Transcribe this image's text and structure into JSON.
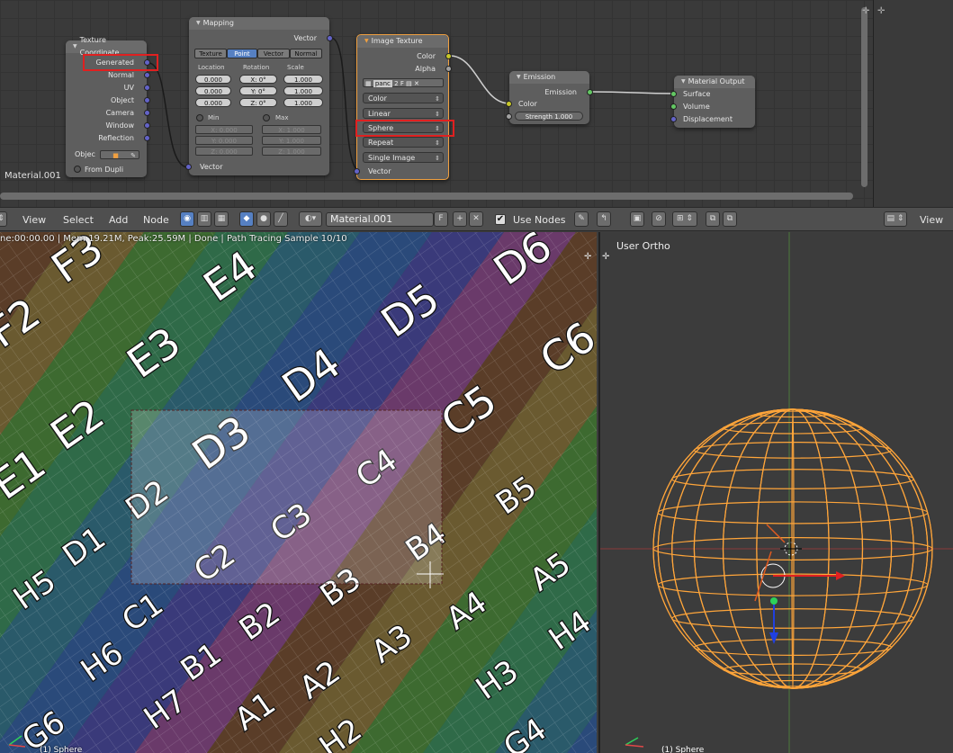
{
  "node_editor": {
    "material_label": "Material.001",
    "nodes": {
      "texture_coordinate": {
        "title": "Texture Coordinate",
        "outputs": [
          "Generated",
          "Normal",
          "UV",
          "Object",
          "Camera",
          "Window",
          "Reflection"
        ],
        "object_label": "Objec",
        "from_dupli": "From Dupli"
      },
      "mapping": {
        "title": "Mapping",
        "output": "Vector",
        "tabs": [
          "Texture",
          "Point",
          "Vector",
          "Normal"
        ],
        "active_tab": "Point",
        "col_labels": [
          "Location",
          "Rotation",
          "Scale"
        ],
        "location": [
          "0.000",
          "0.000",
          "0.000"
        ],
        "rotation": [
          "X: 0°",
          "Y: 0°",
          "Z: 0°"
        ],
        "scale": [
          "1.000",
          "1.000",
          "1.000"
        ],
        "min_label": "Min",
        "max_label": "Max",
        "min_vals": [
          "X: 0.000",
          "Y: 0.000",
          "Z: 0.000"
        ],
        "max_vals": [
          "X: 1.000",
          "Y: 1.000",
          "Z: 1.000"
        ],
        "input": "Vector"
      },
      "image_texture": {
        "title": "Image Texture",
        "outputs": [
          "Color",
          "Alpha"
        ],
        "image_name": "panc",
        "image_users": "2",
        "fake_user": "F",
        "color_space": "Color",
        "interpolation": "Linear",
        "projection": "Sphere",
        "extension": "Repeat",
        "source": "Single Image",
        "input": "Vector"
      },
      "emission": {
        "title": "Emission",
        "output": "Emission",
        "input_color": "Color",
        "strength": "Strength 1.000"
      },
      "material_output": {
        "title": "Material Output",
        "inputs": [
          "Surface",
          "Volume",
          "Displacement"
        ]
      }
    }
  },
  "header": {
    "menus": [
      "View",
      "Select",
      "Add",
      "Node"
    ],
    "material_name": "Material.001",
    "fake_user": "F",
    "use_nodes_label": "Use Nodes",
    "right_view": "View"
  },
  "render_view": {
    "status": "ne:00:00.00 | Mem:19.21M, Peak:25.59M | Done | Path Tracing Sample 10/10",
    "object_label": "(1) Sphere",
    "tiles": [
      "F3",
      "E4",
      "D6",
      "F2",
      "E3",
      "D5",
      "C6",
      "E2",
      "D4",
      "C5",
      "E1",
      "D3",
      "C4",
      "D2",
      "B5",
      "D1",
      "C3",
      "B4",
      "H5",
      "C2",
      "B3",
      "A5",
      "C1",
      "B2",
      "A4",
      "H6",
      "B1",
      "A3",
      "H4",
      "H7",
      "A2",
      "H3",
      "G6",
      "A1",
      "H2",
      "G4"
    ]
  },
  "viewport": {
    "title": "User Ortho",
    "object_label": "(1) Sphere"
  },
  "colors": {
    "wire": "#ffa53a",
    "accent": "#5680c2",
    "highlight": "#e02020"
  }
}
